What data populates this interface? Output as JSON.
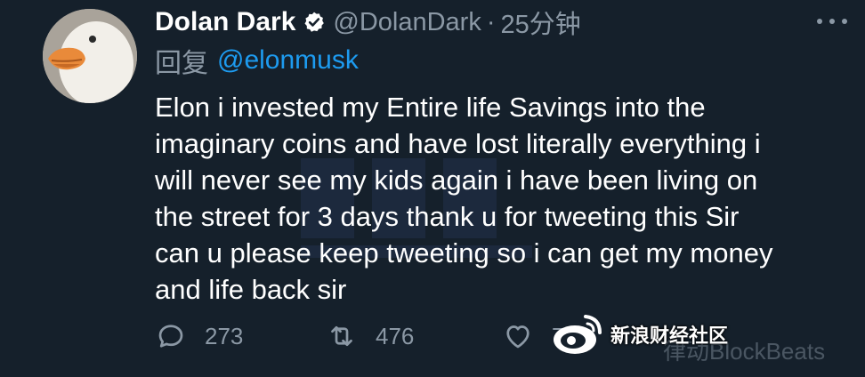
{
  "tweet": {
    "display_name": "Dolan Dark",
    "handle": "@DolanDark",
    "separator": "·",
    "time": "25分钟",
    "reply_prefix": "回复",
    "reply_to": "@elonmusk",
    "body_lines": [
      "Elon i invested my Entire life Savings into the",
      "imaginary coins and have lost literally everything i",
      "will never see my kids again i have been living on",
      "the street for 3 days thank u for tweeting this Sir",
      "can u please keep tweeting so i can get my money",
      "and life back sir"
    ]
  },
  "actions": {
    "reply_count": "273",
    "retweet_count": "476",
    "like_count": "708"
  },
  "watermark": {
    "sina_label": "新浪财经社区",
    "faint_text": "律动BlockBeats"
  },
  "colors": {
    "background": "#15202b",
    "text_primary": "#ffffff",
    "text_secondary": "#8b98a5",
    "link": "#1d9bf0"
  },
  "icons": {
    "verified": "verified-badge-icon",
    "more": "more-dots-icon",
    "reply": "reply-bubble-icon",
    "retweet": "retweet-icon",
    "like": "heart-icon",
    "sina": "sina-eye-logo-icon"
  }
}
